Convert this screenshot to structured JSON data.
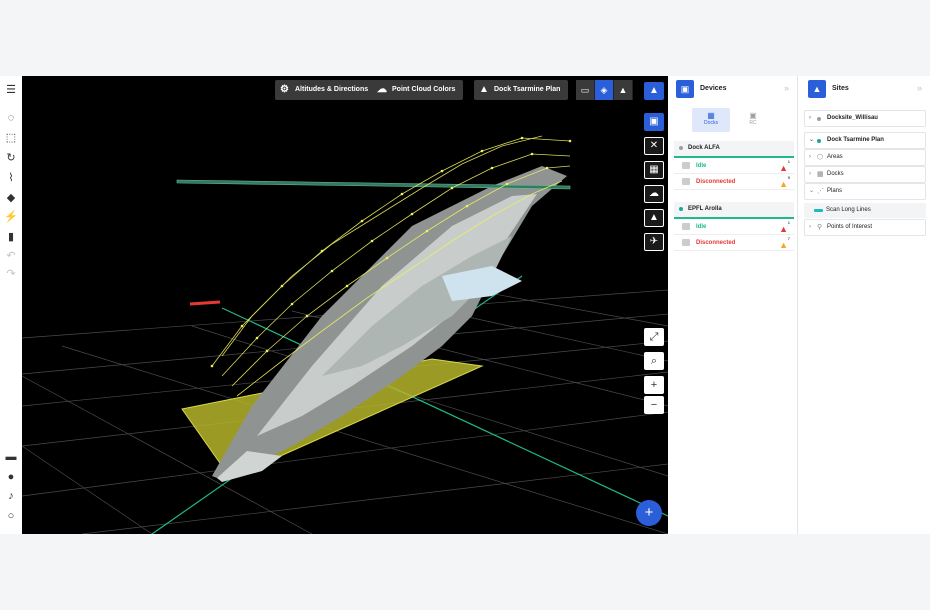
{
  "toolbar": {
    "altitudes_label": "Altitudes & Directions",
    "point_cloud_label": "Point Cloud Colors",
    "plan_label": "Dock Tsarmine Plan"
  },
  "devices_panel": {
    "title": "Devices",
    "tabs": [
      {
        "label": "Docks",
        "active": true
      },
      {
        "label": "RC",
        "active": false
      }
    ],
    "devices": [
      {
        "name": "Dock ALFA",
        "rows": [
          {
            "status": "Idle",
            "alert_count": "1"
          },
          {
            "status": "Disconnected",
            "alert_count": "5"
          }
        ]
      },
      {
        "name": "EPFL Arolla",
        "rows": [
          {
            "status": "Idle",
            "alert_count": "1"
          },
          {
            "status": "Disconnected",
            "alert_count": "7"
          }
        ]
      }
    ]
  },
  "sites_panel": {
    "title": "Sites",
    "sites": [
      {
        "name": "Docksite_Willisau"
      },
      {
        "name": "Dock Tsarmine Plan",
        "children": [
          "Areas",
          "Docks",
          "Plans",
          "Points of Interest"
        ],
        "plan_item": "Scan Long Lines"
      }
    ]
  },
  "colors": {
    "accent": "#2b5fd9",
    "idle": "#1fb98a",
    "disconnected": "#e53935",
    "path": "#f0f060"
  }
}
